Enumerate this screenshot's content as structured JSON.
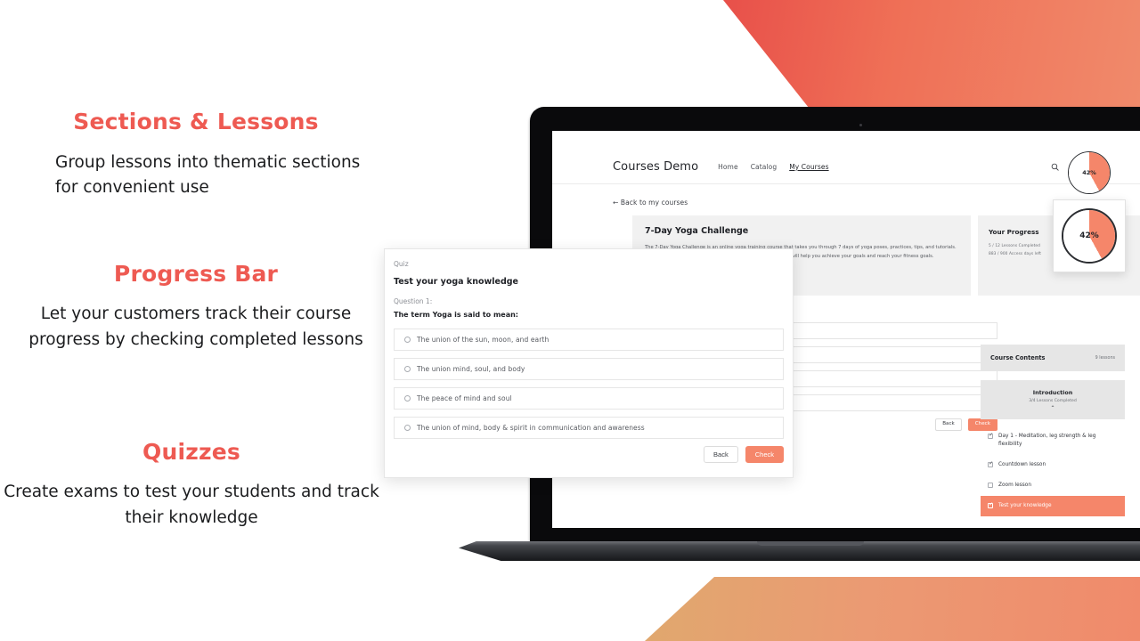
{
  "theme": {
    "accent_red": "#ee5a52",
    "accent_coral": "#f5866a",
    "tan": "#e0a86e"
  },
  "features": [
    {
      "title": "Sections & Lessons",
      "body": "Group lessons into thematic sections for convenient use"
    },
    {
      "title": "Progress Bar",
      "body": "Let your customers track their course progress by checking completed lessons"
    },
    {
      "title": "Quizzes",
      "body": "Create exams to test your students and track their knowledge"
    }
  ],
  "site": {
    "brand": "Courses Demo",
    "nav": [
      {
        "label": "Home",
        "active": false
      },
      {
        "label": "Catalog",
        "active": false
      },
      {
        "label": "My Courses",
        "active": true
      }
    ],
    "icons": [
      "search-icon",
      "account-icon",
      "cart-icon"
    ],
    "back_link": "← Back to my courses",
    "course": {
      "title": "7-Day Yoga Challenge",
      "description": "The 7-Day Yoga Challenge is an online yoga training course that takes you through 7 days of yoga poses, practices, tips, and tutorials. Whether you're a beginner or an experienced yogi, this course will help you achieve your goals and reach your fitness goals."
    },
    "progress": {
      "heading": "Your Progress",
      "lessons_line": "5 / 12 Lessons Completed",
      "access_line": "883 / 900 Access days left",
      "percent": 42,
      "percent_label": "42%"
    },
    "contents": {
      "heading": "Course Contents",
      "count": "9 lessons",
      "section": {
        "title": "Introduction",
        "sub": "3/4 Lessons Completed",
        "chevron": "⌃"
      },
      "lessons": [
        {
          "label": "Day 1 - Meditation, leg strength & leg flexibility",
          "checked": true,
          "active": false
        },
        {
          "label": "Countdown lesson",
          "checked": true,
          "active": false
        },
        {
          "label": "Zoom lesson",
          "checked": false,
          "active": false
        },
        {
          "label": "Test your knowledge",
          "checked": true,
          "active": true
        }
      ]
    }
  },
  "quiz": {
    "kicker": "Quiz",
    "title": "Test your yoga knowledge",
    "question_number": "Question 1:",
    "question": "The term Yoga is said to mean:",
    "options": [
      "The union of the sun, moon, and earth",
      "The union mind, soul, and body",
      "The peace of mind and soul",
      "The union of mind, body & spirit in communication and awareness"
    ],
    "back_label": "Back",
    "check_label": "Check"
  }
}
